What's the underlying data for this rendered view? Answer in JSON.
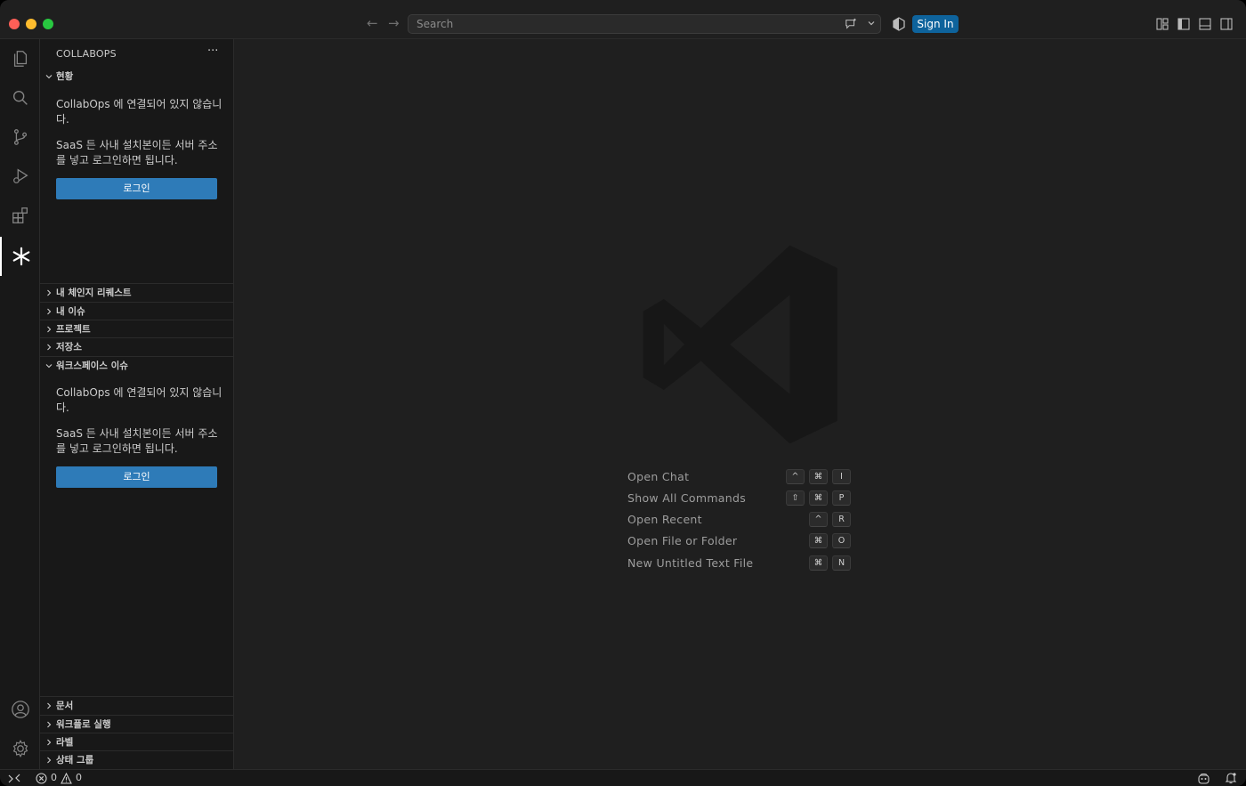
{
  "titlebar": {
    "search_placeholder": "Search",
    "sign_in_label": "Sign In",
    "icons": [
      "arrow-left-icon",
      "arrow-right-icon",
      "chat-icon",
      "chevron-down-icon",
      "accounts-icon",
      "customize-layout-icon",
      "toggle-primary-sidebar-icon",
      "toggle-panel-icon",
      "toggle-secondary-sidebar-icon"
    ]
  },
  "activitybar": {
    "items": [
      "explorer-icon",
      "search-icon",
      "source-control-icon",
      "run-debug-icon",
      "extensions-icon",
      "collabops-icon"
    ],
    "bottom": [
      "account-icon",
      "gear-icon"
    ]
  },
  "sidebar": {
    "title": "COLLABOPS",
    "more": "···",
    "status_section": {
      "label": "현황",
      "msg1": "CollabOps 에 연결되어 있지 않습니다.",
      "msg2": "SaaS 든 사내 설치본이든 서버 주소를 넣고 로그인하면 됩니다.",
      "button": "로그인"
    },
    "collapsed_sections": [
      "내 체인지 리퀘스트",
      "내 이슈",
      "프로젝트",
      "저장소"
    ],
    "workspace_section": {
      "label": "워크스페이스 이슈",
      "msg1": "CollabOps 에 연결되어 있지 않습니다.",
      "msg2": "SaaS 든 사내 설치본이든 서버 주소를 넣고 로그인하면 됩니다.",
      "button": "로그인"
    },
    "bottom_sections": [
      "문서",
      "워크플로 실행",
      "라벨",
      "상태 그룹"
    ]
  },
  "editor": {
    "shortcuts": [
      {
        "label": "Open Chat",
        "keys": [
          "^",
          "⌘",
          "I"
        ]
      },
      {
        "label": "Show All Commands",
        "keys": [
          "⇧",
          "⌘",
          "P"
        ]
      },
      {
        "label": "Open Recent",
        "keys": [
          "^",
          "R"
        ]
      },
      {
        "label": "Open File or Folder",
        "keys": [
          "⌘",
          "O"
        ]
      },
      {
        "label": "New Untitled Text File",
        "keys": [
          "⌘",
          "N"
        ]
      }
    ]
  },
  "statusbar": {
    "errors": "0",
    "warnings": "0"
  },
  "colors": {
    "button": "#2e7bb8",
    "sign_in": "#0e639c",
    "editor_bg": "#1f1f1f",
    "sidebar_bg": "#181818"
  }
}
